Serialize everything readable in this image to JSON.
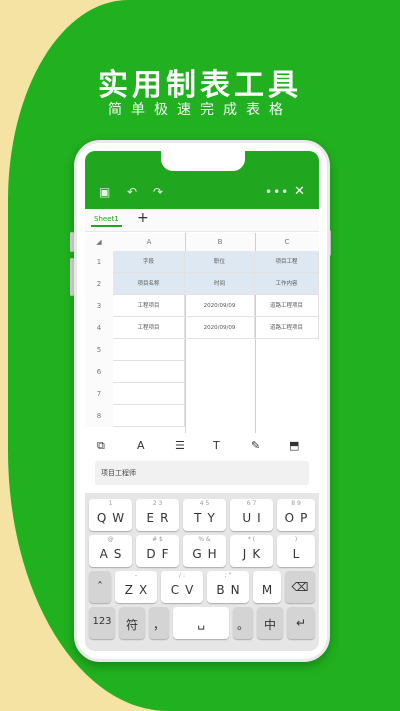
{
  "headline": {
    "title": "实用制表工具",
    "subtitle": "简单极速完成表格"
  },
  "toolbar": {
    "more": "•••",
    "close": "✕"
  },
  "tabs": {
    "sheet": "Sheet1",
    "add": "+"
  },
  "columns": [
    "A",
    "B",
    "C"
  ],
  "rows": [
    "1",
    "2",
    "3",
    "4",
    "5",
    "6",
    "7",
    "8"
  ],
  "cells": {
    "r1": [
      "字段",
      "职位",
      "项目工程"
    ],
    "r2": [
      "项目名称",
      "时间",
      "工作内容"
    ],
    "r3": [
      "工程项目",
      "2020/09/09",
      "道路工程项目"
    ],
    "r4": [
      "工程项目",
      "2020/09/09",
      "道路工程项目"
    ]
  },
  "format": {
    "text": "A",
    "t": "T"
  },
  "edit_value": "项目工程师",
  "keyboard": {
    "row1": [
      {
        "d": "1",
        "k": "QW"
      },
      {
        "d": "2  3",
        "k": "ER"
      },
      {
        "d": "4  5",
        "k": "TY"
      },
      {
        "d": "6  7",
        "k": "UI"
      },
      {
        "d": "8  9",
        "k": "OP"
      }
    ],
    "row2": [
      {
        "d": "@",
        "k": "AS"
      },
      {
        "d": "#  $",
        "k": "DF"
      },
      {
        "d": "%  &",
        "k": "GH"
      },
      {
        "d": "*  (",
        "k": "JK"
      },
      {
        "d": ")",
        "k": "L"
      }
    ],
    "row3": [
      {
        "d": "",
        "k": "ˆ"
      },
      {
        "d": "-",
        "k": "ZX"
      },
      {
        "d": "/  :",
        "k": "CV"
      },
      {
        "d": ";  \"",
        "k": "BN"
      },
      {
        "d": "",
        "k": "M"
      }
    ],
    "num": "123",
    "sym": "符",
    "comma": "，",
    "period": "。",
    "zh": "中"
  }
}
